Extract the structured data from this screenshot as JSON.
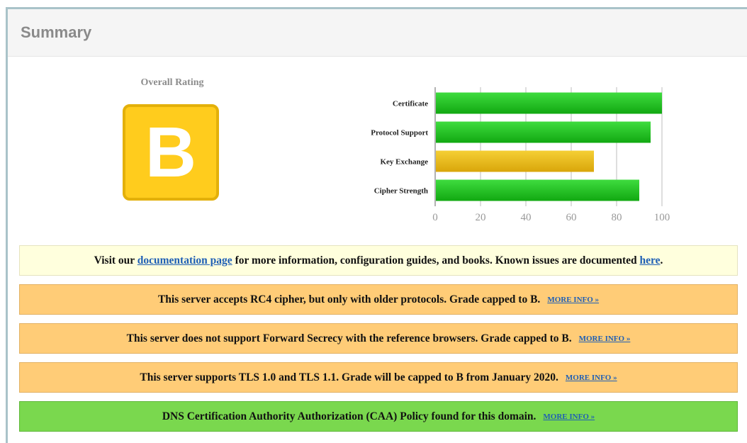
{
  "header": {
    "title": "Summary"
  },
  "rating": {
    "label": "Overall Rating",
    "grade": "B"
  },
  "chart_data": {
    "type": "bar",
    "orientation": "horizontal",
    "categories": [
      "Certificate",
      "Protocol Support",
      "Key Exchange",
      "Cipher Strength"
    ],
    "values": [
      100,
      95,
      70,
      90
    ],
    "colors": [
      "#1fbf1f",
      "#1fbf1f",
      "#e3b512",
      "#1fbf1f"
    ],
    "xlim": [
      0,
      100
    ],
    "xticks": [
      "0",
      "20",
      "40",
      "60",
      "80",
      "100"
    ],
    "grid": true
  },
  "info_notice": {
    "prefix": "Visit our ",
    "doc_link": "documentation page",
    "middle": " for more information, configuration guides, and books. Known issues are documented ",
    "here_link": "here",
    "suffix": "."
  },
  "notices": [
    {
      "text": "This server accepts RC4 cipher, but only with older protocols. Grade capped to B.",
      "more": "MORE INFO »"
    },
    {
      "text": "This server does not support Forward Secrecy with the reference browsers. Grade capped to B.",
      "more": "MORE INFO »"
    },
    {
      "text": "This server supports TLS 1.0 and TLS 1.1. Grade will be capped to B from January 2020.",
      "more": "MORE INFO »"
    },
    {
      "text": "DNS Certification Authority Authorization (CAA) Policy found for this domain.",
      "more": "MORE INFO »"
    }
  ]
}
